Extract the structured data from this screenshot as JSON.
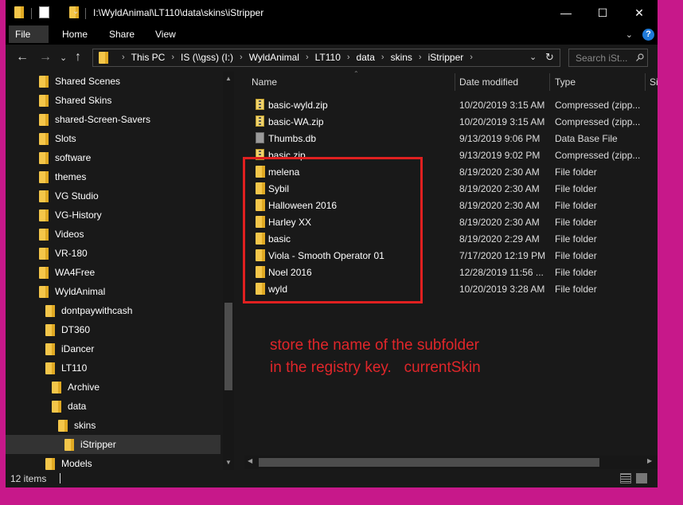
{
  "titlebar": {
    "path": "I:\\WyldAnimal\\LT110\\data\\skins\\iStripper",
    "minimize": "—",
    "maximize": "☐",
    "close": "✕"
  },
  "ribbon": {
    "tabs": [
      "File",
      "Home",
      "Share",
      "View"
    ],
    "expand": "⌄",
    "help": "?"
  },
  "nav": {
    "back": "←",
    "forward": "→",
    "recent": "⌄",
    "up": "↑",
    "breadcrumbs": [
      "This PC",
      "IS (\\\\gss) (I:)",
      "WyldAnimal",
      "LT110",
      "data",
      "skins",
      "iStripper"
    ],
    "dropdown": "⌄",
    "refresh": "↻",
    "search_placeholder": "Search iSt..."
  },
  "sidebar": {
    "items": [
      "Shared Scenes",
      "Shared Skins",
      "shared-Screen-Savers",
      "Slots",
      "software",
      "themes",
      "VG Studio",
      "VG-History",
      "Videos",
      "VR-180",
      "WA4Free",
      "WyldAnimal",
      "dontpaywithcash",
      "DT360",
      "iDancer",
      "LT110",
      "Archive",
      "data",
      "skins",
      "iStripper",
      "Models"
    ],
    "selected": "iStripper"
  },
  "columns": [
    "Name",
    "Date modified",
    "Type",
    "Si"
  ],
  "files": [
    {
      "name": "basic-wyld.zip",
      "date": "10/20/2019 3:15 AM",
      "type": "Compressed (zipp...",
      "icon": "zip-icon"
    },
    {
      "name": "basic-WA.zip",
      "date": "10/20/2019 3:15 AM",
      "type": "Compressed (zipp...",
      "icon": "zip-icon"
    },
    {
      "name": "Thumbs.db",
      "date": "9/13/2019 9:06 PM",
      "type": "Data Base File",
      "icon": "db-icon"
    },
    {
      "name": "basic.zip",
      "date": "9/13/2019 9:02 PM",
      "type": "Compressed (zipp...",
      "icon": "zip-icon"
    },
    {
      "name": "melena",
      "date": "8/19/2020 2:30 AM",
      "type": "File folder",
      "icon": "folder-icon"
    },
    {
      "name": "Sybil",
      "date": "8/19/2020 2:30 AM",
      "type": "File folder",
      "icon": "folder-icon"
    },
    {
      "name": "Halloween 2016",
      "date": "8/19/2020 2:30 AM",
      "type": "File folder",
      "icon": "folder-icon"
    },
    {
      "name": "Harley XX",
      "date": "8/19/2020 2:30 AM",
      "type": "File folder",
      "icon": "folder-icon"
    },
    {
      "name": "basic",
      "date": "8/19/2020 2:29 AM",
      "type": "File folder",
      "icon": "folder-icon"
    },
    {
      "name": "Viola - Smooth Operator 01",
      "date": "7/17/2020 12:19 PM",
      "type": "File folder",
      "icon": "folder-icon"
    },
    {
      "name": "Noel 2016",
      "date": "12/28/2019 11:56 ...",
      "type": "File folder",
      "icon": "folder-icon"
    },
    {
      "name": "wyld",
      "date": "10/20/2019 3:28 AM",
      "type": "File folder",
      "icon": "folder-icon"
    }
  ],
  "annotation": {
    "line1": "store the name of the subfolder",
    "line2": "in the registry key.   currentSkin",
    "color": "#e0262a"
  },
  "status": {
    "count": "12 items"
  },
  "colors": {
    "background": "#c7188a",
    "window": "#191919",
    "folder": "#f4c64a",
    "highlight": "#e02020"
  }
}
